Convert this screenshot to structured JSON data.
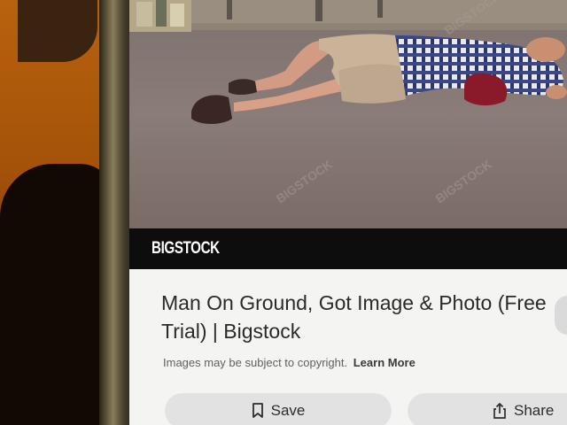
{
  "result": {
    "source": "BIGSTOCK",
    "title": "Man On Ground, Got Image & Photo (Free Trial) | Bigstock",
    "copyright_notice": "Images may be subject to copyright.",
    "learn_more_label": "Learn More"
  },
  "actions": {
    "save_label": "Save",
    "share_label": "Share"
  },
  "icons": {
    "save": "bookmark-icon",
    "share": "share-icon"
  },
  "colors": {
    "source_bar": "#0d0d0d",
    "panel": "#f4f4f2",
    "button": "#e2e2e2"
  }
}
